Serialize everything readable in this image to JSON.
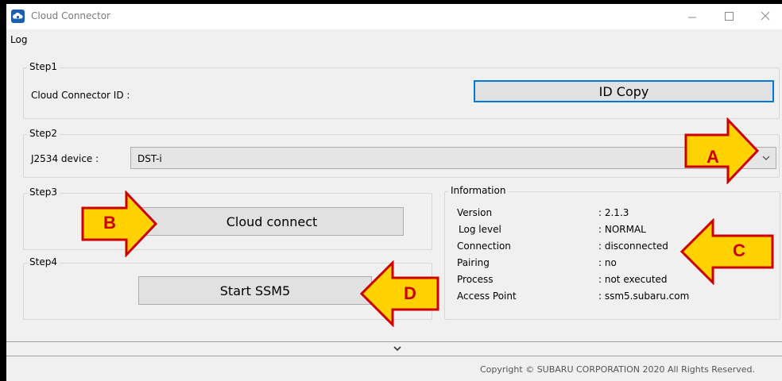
{
  "window": {
    "title": "Cloud Connector",
    "controls": [
      "minimize-icon",
      "maximize-icon",
      "close-icon"
    ]
  },
  "menu": {
    "items": [
      {
        "label": "Log"
      }
    ]
  },
  "step1": {
    "title": "Step1",
    "id_label": "Cloud Connector  ID :",
    "id_value": "",
    "copy_button": "ID Copy"
  },
  "step2": {
    "title": "Step2",
    "device_label": "J2534 device :",
    "device_selected": "DST-i"
  },
  "step3": {
    "title": "Step3",
    "connect_button": "Cloud connect"
  },
  "step4": {
    "title": "Step4",
    "start_button": "Start SSM5"
  },
  "information": {
    "title": "Information",
    "rows": [
      {
        "key": "Version",
        "value": ": 2.1.3"
      },
      {
        "key": "Log level",
        "value": ": NORMAL"
      },
      {
        "key": "Connection",
        "value": ": disconnected"
      },
      {
        "key": "Pairing",
        "value": ": no"
      },
      {
        "key": "Process",
        "value": ": not executed"
      },
      {
        "key": "Access Point",
        "value": ": ssm5.subaru.com"
      }
    ]
  },
  "footer": {
    "copyright": "Copyright © SUBARU CORPORATION 2020 All Rights Reserved."
  },
  "callouts": {
    "a": "A",
    "b": "B",
    "c": "C",
    "d": "D"
  },
  "colors": {
    "callout_fill": "#ffd200",
    "callout_border": "#cc0000",
    "focus_border": "#0078d7"
  }
}
